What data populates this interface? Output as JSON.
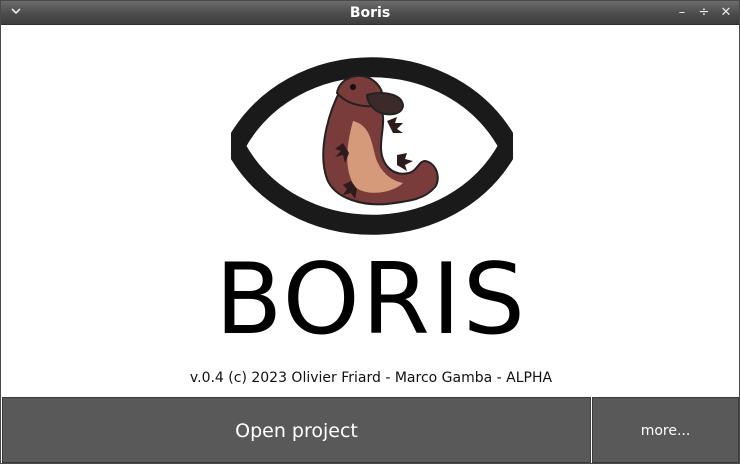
{
  "window": {
    "title": "Boris",
    "menu_icon": "chevron-down-icon",
    "controls": {
      "minimize": "–",
      "maximize": "÷",
      "close": "✕"
    }
  },
  "splash": {
    "app_name": "BORIS",
    "version_text": "v.0.4 (c) 2023 Olivier Friard - Marco Gamba - ALPHA",
    "logo_icon": "platypus-eye-logo"
  },
  "buttons": {
    "open_project": "Open project",
    "more": "more..."
  },
  "colors": {
    "titlebar": "#4c4c4c",
    "button_bg": "#595959",
    "button_text": "#ffffff",
    "eye_outline": "#1a1a1a",
    "platypus_body": "#7a3b3b",
    "platypus_belly": "#d49a7a"
  }
}
